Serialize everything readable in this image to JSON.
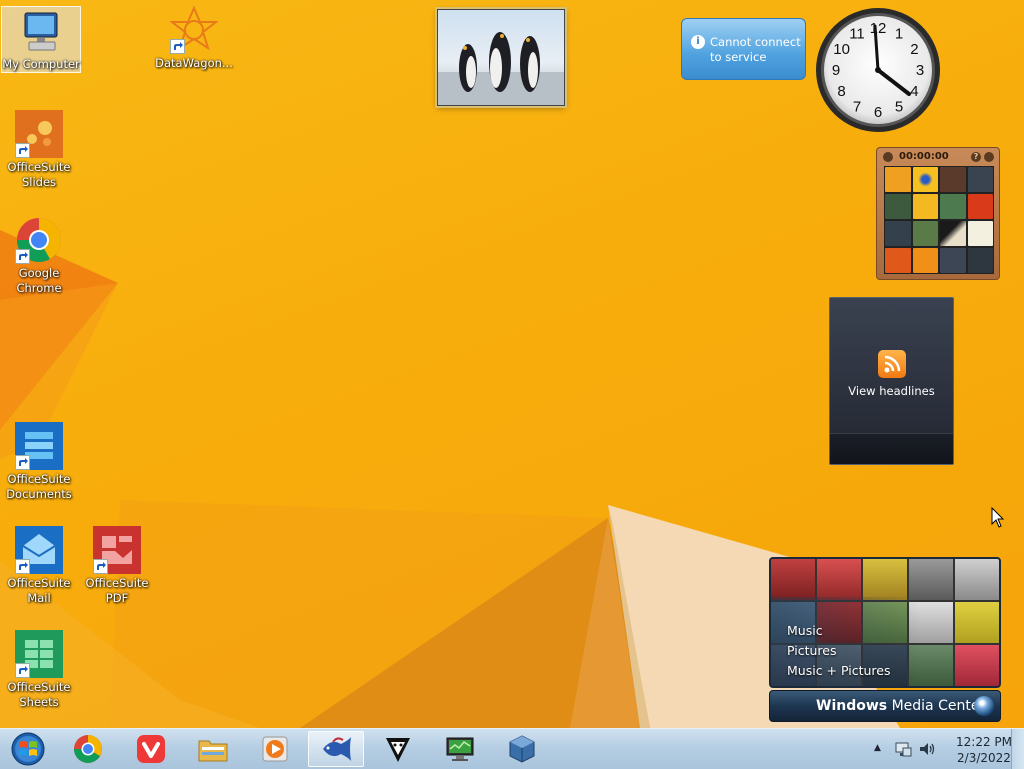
{
  "desktop": {
    "icons": [
      {
        "label": "My Computer"
      },
      {
        "label": "DataWagon..."
      },
      {
        "label": "OfficeSuite Slides"
      },
      {
        "label": "Google Chrome"
      },
      {
        "label": "OfficeSuite Documents"
      },
      {
        "label": "OfficeSuite Mail"
      },
      {
        "label": "OfficeSuite PDF"
      },
      {
        "label": "OfficeSuite Sheets"
      }
    ]
  },
  "gadgets": {
    "weather": {
      "message": "Cannot connect to service",
      "info_icon": "i"
    },
    "clock": {
      "numbers": [
        "12",
        "1",
        "2",
        "3",
        "4",
        "5",
        "6",
        "7",
        "8",
        "9",
        "10",
        "11"
      ]
    },
    "puzzle": {
      "timer": "00:00:00",
      "help": "?"
    },
    "feeds": {
      "label": "View headlines"
    },
    "media_center": {
      "menu": [
        "Music",
        "Pictures",
        "Music + Pictures"
      ],
      "brand_light": "Windows",
      "brand_rest": " Media Center"
    }
  },
  "taskbar": {
    "apps": [
      "windows-start",
      "chrome",
      "vivaldi",
      "file-explorer",
      "media-player",
      "active-app",
      "security-app",
      "monitor-app",
      "virtualbox"
    ],
    "tray": {
      "time": "12:22 PM",
      "date": "2/3/2022"
    }
  },
  "colors": {
    "accent": "#f8b20f",
    "taskbar": "#b4cde2"
  }
}
